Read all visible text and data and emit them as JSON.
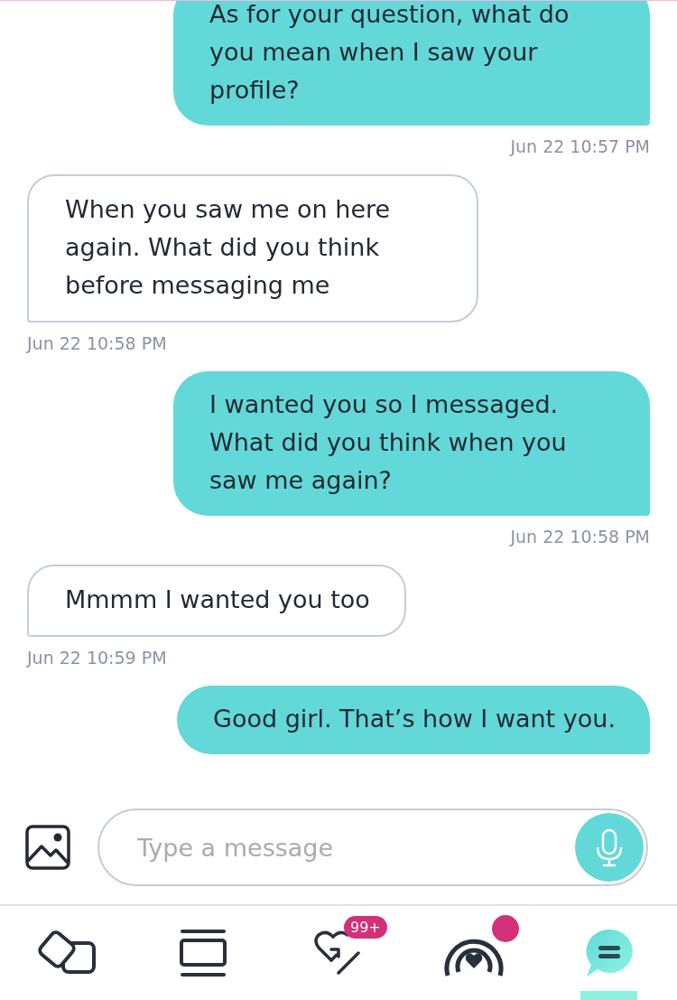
{
  "messages": [
    {
      "kind": "sent",
      "text": "As for your question, what do you mean when I saw your profile?",
      "time": "Jun 22 10:57 PM"
    },
    {
      "kind": "received",
      "text": "When you saw me on here again. What did you think before messaging me",
      "time": "Jun 22 10:58 PM"
    },
    {
      "kind": "sent",
      "text": "I wanted you so I messaged. What did you think when you saw me again?",
      "time": "Jun 22 10:58 PM"
    },
    {
      "kind": "received",
      "text": "Mmmm I wanted you too",
      "time": "Jun 22 10:59 PM"
    },
    {
      "kind": "sent",
      "text": "Good girl. That’s how I want you."
    }
  ],
  "composer": {
    "placeholder": "Type a message"
  },
  "nav": [
    {
      "kind": "cards",
      "selected": false,
      "dot": false
    },
    {
      "kind": "feed",
      "selected": false,
      "dot": false
    },
    {
      "kind": "likes",
      "selected": false,
      "dot": false,
      "badge": "99+"
    },
    {
      "kind": "live",
      "selected": false,
      "dot": true
    },
    {
      "kind": "chat",
      "selected": true,
      "dot": false
    }
  ]
}
